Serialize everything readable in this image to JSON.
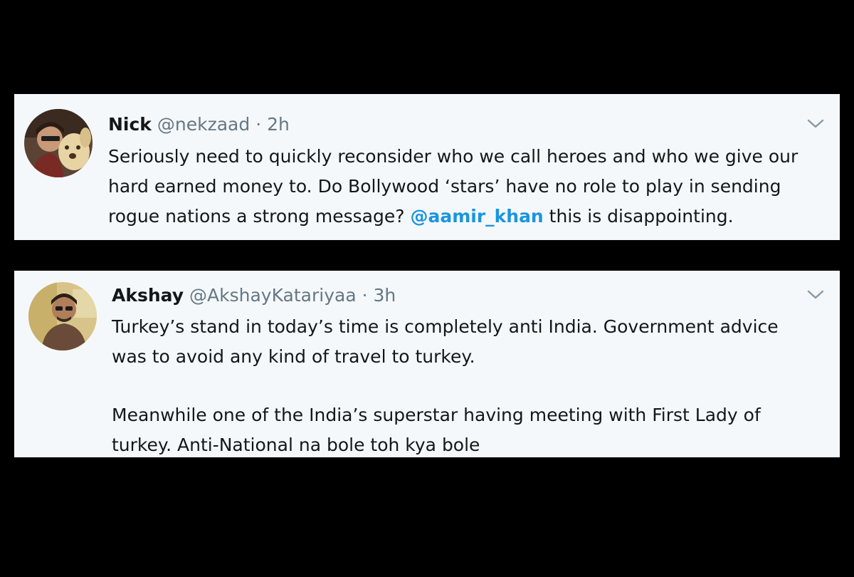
{
  "tweets": [
    {
      "name": "Nick",
      "handle": "@nekzaad",
      "separator": "·",
      "time": "2h",
      "avatar_icon": "profile-photo-with-dog",
      "menu_icon": "chevron-down-icon",
      "lines": {
        "l1": "Seriously need to quickly reconsider who we call heroes and who we give our",
        "l2": "hard earned money to. Do Bollywood ‘stars’ have no role to play in sending",
        "l3_pre": "rogue nations a strong message? ",
        "l3_mention": "@aamir_khan",
        "l3_post": " this is disappointing."
      }
    },
    {
      "name": "Akshay",
      "handle": "@AkshayKatariyaa",
      "separator": "·",
      "time": "3h",
      "avatar_icon": "profile-photo-man-sunglasses",
      "menu_icon": "chevron-down-icon",
      "lines": {
        "l1": "Turkey’s stand in today’s time is completely anti India. Government advice",
        "l2": "was to avoid any kind of travel to turkey.",
        "l3": "Meanwhile one of the India’s superstar having meeting with First Lady of",
        "l4": "turkey.  Anti-National na bole toh kya bole"
      }
    }
  ],
  "colors": {
    "background": "#000000",
    "card": "#f5f8fa",
    "text": "#14171a",
    "secondary": "#657786",
    "link": "#1b95e0"
  }
}
